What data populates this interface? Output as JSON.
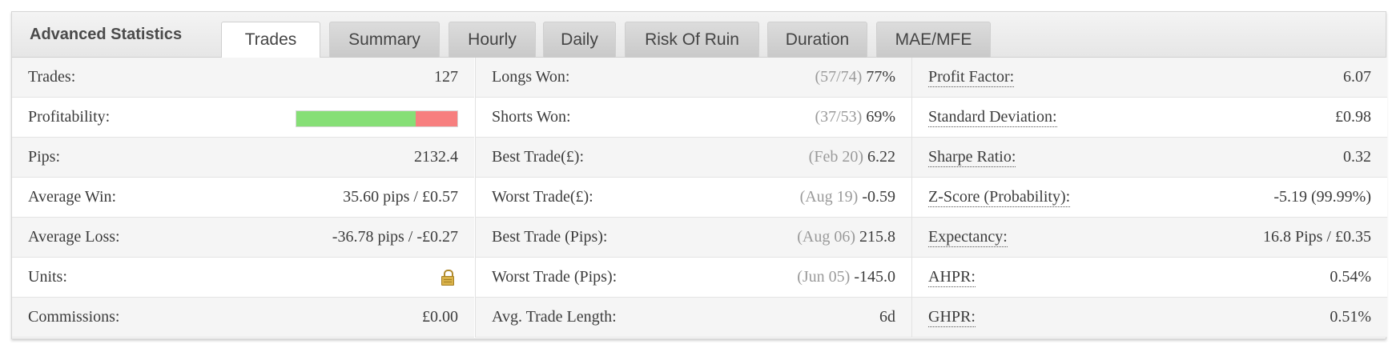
{
  "panel": {
    "title": "Advanced Statistics"
  },
  "tabs": [
    {
      "label": "Trades",
      "active": true
    },
    {
      "label": "Summary"
    },
    {
      "label": "Hourly"
    },
    {
      "label": "Daily"
    },
    {
      "label": "Risk Of Ruin"
    },
    {
      "label": "Duration"
    },
    {
      "label": "MAE/MFE"
    }
  ],
  "col1": [
    {
      "label": "Trades:",
      "value": "127"
    },
    {
      "label": "Profitability:",
      "won_fraction": 0.74,
      "won_color": "#86df76",
      "lost_color": "#f77f7f"
    },
    {
      "label": "Pips:",
      "value": "2132.4"
    },
    {
      "label": "Average Win:",
      "value": "35.60 pips / £0.57"
    },
    {
      "label": "Average Loss:",
      "value": "-36.78 pips / -£0.27"
    },
    {
      "label": "Units:",
      "icon": "lock-icon"
    },
    {
      "label": "Commissions:",
      "value": "£0.00"
    }
  ],
  "col2": [
    {
      "label": "Longs Won:",
      "muted": "(57/74)",
      "value": "77%"
    },
    {
      "label": "Shorts Won:",
      "muted": "(37/53)",
      "value": "69%"
    },
    {
      "label": "Best Trade(£):",
      "muted": "(Feb 20)",
      "value": "6.22"
    },
    {
      "label": "Worst Trade(£):",
      "muted": "(Aug 19)",
      "value": "-0.59"
    },
    {
      "label": "Best Trade (Pips):",
      "muted": "(Aug 06)",
      "value": "215.8"
    },
    {
      "label": "Worst Trade (Pips):",
      "muted": "(Jun 05)",
      "value": "-145.0"
    },
    {
      "label": "Avg. Trade Length:",
      "muted": "",
      "value": "6d"
    }
  ],
  "col3": [
    {
      "label": "Profit Factor:",
      "value": "6.07"
    },
    {
      "label": "Standard Deviation:",
      "value": "£0.98"
    },
    {
      "label": "Sharpe Ratio:",
      "value": "0.32"
    },
    {
      "label": "Z-Score (Probability):",
      "value": "-5.19 (99.99%)"
    },
    {
      "label": "Expectancy:",
      "value": "16.8 Pips / £0.35"
    },
    {
      "label": "AHPR:",
      "value": "0.54%"
    },
    {
      "label": "GHPR:",
      "value": "0.51%"
    }
  ]
}
